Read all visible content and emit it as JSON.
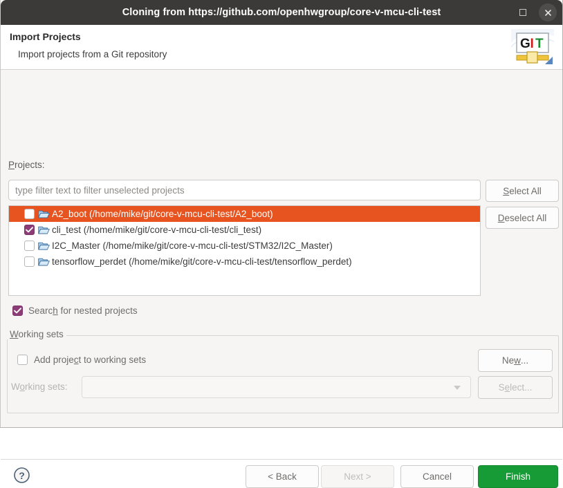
{
  "window": {
    "title": "Cloning from https://github.com/openhwgroup/core-v-mcu-cli-test",
    "maximize_icon": "maximize-icon",
    "close_icon": "close-icon"
  },
  "header": {
    "title": "Import Projects",
    "subtitle": "Import projects from a Git repository",
    "logo": {
      "icon": "git-logo-icon",
      "text_g": "G",
      "text_bar": "I",
      "text_t": "T"
    }
  },
  "projects_section": {
    "label": "Projects:",
    "label_mnemonic": "P",
    "filter": {
      "value": "",
      "placeholder": "type filter text to filter unselected projects"
    },
    "select_all_label": "Select All",
    "deselect_all_label": "Deselect All",
    "rows": [
      {
        "label": "A2_boot (/home/mike/git/core-v-mcu-cli-test/A2_boot)",
        "checked": false,
        "selected": true,
        "icon": "folder-icon"
      },
      {
        "label": "cli_test (/home/mike/git/core-v-mcu-cli-test/cli_test)",
        "checked": true,
        "selected": false,
        "icon": "folder-icon"
      },
      {
        "label": "I2C_Master (/home/mike/git/core-v-mcu-cli-test/STM32/I2C_Master)",
        "checked": false,
        "selected": false,
        "icon": "folder-icon"
      },
      {
        "label": "tensorflow_perdet (/home/mike/git/core-v-mcu-cli-test/tensorflow_perdet)",
        "checked": false,
        "selected": false,
        "icon": "folder-icon"
      }
    ],
    "nested_checkbox": {
      "label": "Search for nested projects",
      "checked": true
    }
  },
  "working_sets": {
    "group_label": "Working sets",
    "add_checkbox": {
      "label": "Add project to working sets",
      "checked": false
    },
    "combo_label": "Working sets:",
    "combo_value": "",
    "new_button": "New...",
    "select_button": "Select..."
  },
  "footer": {
    "help_icon": "help-icon",
    "back": "< Back",
    "next": "Next >",
    "cancel": "Cancel",
    "finish": "Finish"
  },
  "colors": {
    "selection": "#e8541f",
    "checkbox_checked": "#8c3d78",
    "finish_button": "#179b36",
    "titlebar": "#3b3a38"
  }
}
